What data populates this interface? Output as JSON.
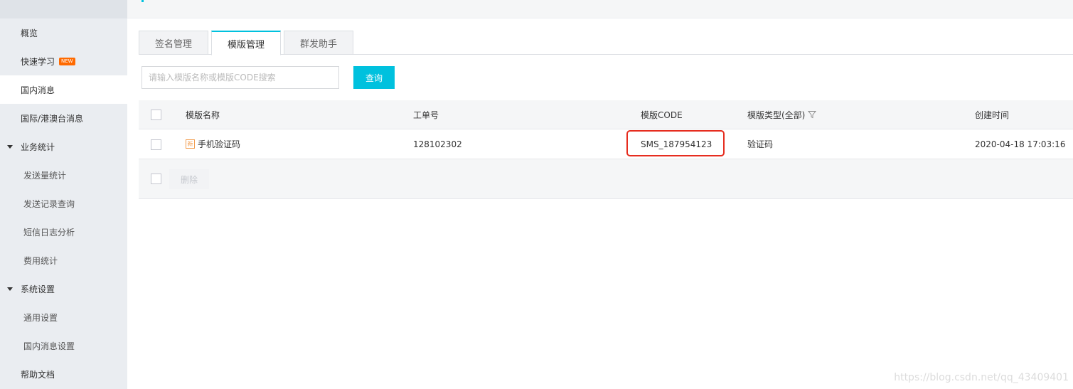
{
  "sidebar": {
    "items": [
      {
        "label": "概览"
      },
      {
        "label": "快速学习",
        "badge": "NEW"
      },
      {
        "label": "国内消息"
      },
      {
        "label": "国际/港澳台消息"
      },
      {
        "label": "业务统计"
      },
      {
        "label": "发送量统计"
      },
      {
        "label": "发送记录查询"
      },
      {
        "label": "短信日志分析"
      },
      {
        "label": "费用统计"
      },
      {
        "label": "系统设置"
      },
      {
        "label": "通用设置"
      },
      {
        "label": "国内消息设置"
      },
      {
        "label": "帮助文档"
      }
    ]
  },
  "tabs": [
    {
      "label": "签名管理"
    },
    {
      "label": "模版管理"
    },
    {
      "label": "群发助手"
    }
  ],
  "search": {
    "placeholder": "请输入模版名称或模版CODE搜索",
    "button_label": "查询"
  },
  "table": {
    "headers": {
      "name": "模版名称",
      "order_no": "工单号",
      "code": "模版CODE",
      "type": "模版类型(全部)",
      "created": "创建时间"
    },
    "rows": [
      {
        "tag": "新",
        "name": "手机验证码",
        "order_no": "128102302",
        "code": "SMS_187954123",
        "type": "验证码",
        "created": "2020-04-18 17:03:16"
      }
    ],
    "delete_label": "删除"
  },
  "watermark": "https://blog.csdn.net/qq_43409401",
  "colors": {
    "accent": "#00c1de",
    "highlight": "#e62d1f",
    "sidebar_bg": "#eaedf1",
    "badge": "#ff6a00"
  }
}
